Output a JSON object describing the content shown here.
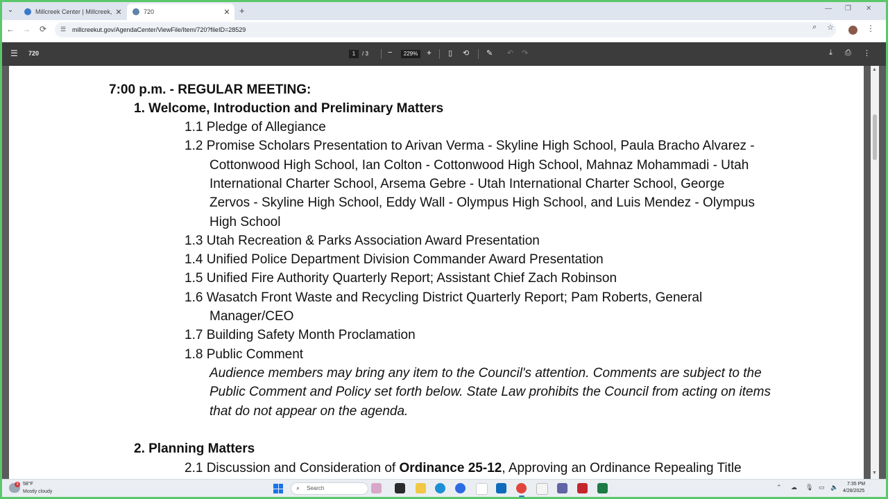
{
  "browser": {
    "tabs": [
      {
        "title": "Millcreek Center | Millcreek, UT",
        "active": false
      },
      {
        "title": "720",
        "active": true
      }
    ],
    "new_tab": "+",
    "url": "millcreekut.gov/AgendaCenter/ViewFile/Item/720?fileID=28529",
    "window_controls": {
      "minimize": "—",
      "restore": "❐",
      "close": "✕"
    }
  },
  "pdf_toolbar": {
    "file_name": "720",
    "page_current": "1",
    "page_total": "/ 3",
    "zoom": "229%"
  },
  "agenda": {
    "heading": "7:00 p.m. - REGULAR MEETING:",
    "section1": "1. Welcome, Introduction and Preliminary Matters",
    "item_1_1": "1.1 Pledge of Allegiance",
    "item_1_2_lines": [
      "1.2 Promise Scholars Presentation to Arivan Verma - Skyline High School, Paula Bracho Alvarez -",
      "Cottonwood High School, Ian Colton - Cottonwood High School, Mahnaz Mohammadi - Utah",
      "International Charter School, Arsema Gebre - Utah International Charter School, George",
      "Zervos - Skyline High School, Eddy Wall - Olympus High School, and Luis Mendez - Olympus",
      "High School"
    ],
    "item_1_3": "1.3 Utah Recreation & Parks Association Award Presentation",
    "item_1_4": "1.4 Unified Police Department Division Commander Award Presentation",
    "item_1_5": "1.5 Unified Fire Authority Quarterly Report; Assistant Chief Zach Robinson",
    "item_1_6_lines": [
      "1.6 Wasatch Front Waste and Recycling District Quarterly Report; Pam Roberts, General",
      "Manager/CEO"
    ],
    "item_1_7": "1.7 Building Safety Month Proclamation",
    "item_1_8": "1.8 Public Comment",
    "public_comment_note_lines": [
      "Audience members may bring any item to the Council's attention. Comments are subject to the",
      "Public Comment and Policy set forth below. State Law prohibits the Council from acting on items",
      "that do not appear on the agenda."
    ],
    "section2": "2. Planning Matters",
    "item_2_1_prefix": "2.1 Discussion and Consideration of ",
    "item_2_1_bold": "Ordinance 25-12",
    "item_2_1_suffix": ", Approving an Ordinance Repealing Title"
  },
  "taskbar": {
    "weather_badge": "3",
    "temperature": "58°F",
    "condition": "Mostly cloudy",
    "search_label": "Search",
    "time": "7:35 PM",
    "date": "4/28/2025"
  },
  "colors": {
    "screen_border": "#59c76a",
    "pdf_toolbar": "#3c3c3c",
    "viewer_bg": "#5b5b5b",
    "tab_strip": "#dfe5ee"
  }
}
